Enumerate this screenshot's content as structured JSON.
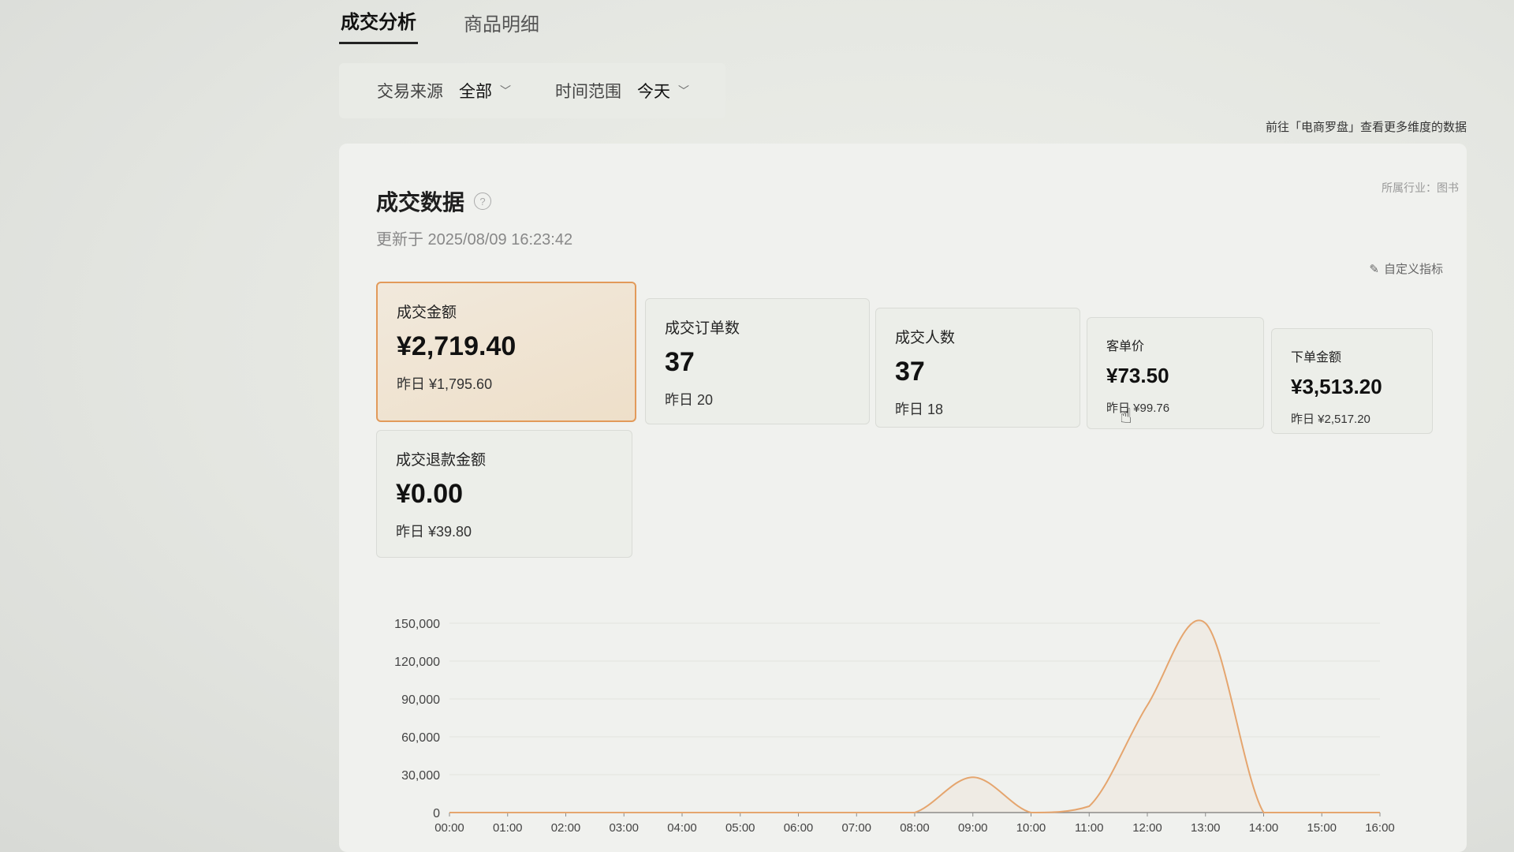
{
  "tabs": [
    {
      "label": "成交分析",
      "active": true
    },
    {
      "label": "商品明细",
      "active": false
    }
  ],
  "filters": {
    "source_label": "交易来源",
    "source_value": "全部",
    "time_label": "时间范围",
    "time_value": "今天"
  },
  "header": {
    "link_text": "前往「电商罗盘」查看更多维度的数据",
    "industry": "所属行业：图书",
    "title": "成交数据",
    "updated": "更新于 2025/08/09 16:23:42",
    "custom_metrics": "自定义指标"
  },
  "metrics": [
    {
      "label": "成交金额",
      "value": "¥2,719.40",
      "prev": "昨日 ¥1,795.60",
      "active": true
    },
    {
      "label": "成交订单数",
      "value": "37",
      "prev": "昨日 20",
      "active": false
    },
    {
      "label": "成交人数",
      "value": "37",
      "prev": "昨日 18",
      "active": false
    },
    {
      "label": "客单价",
      "value": "¥73.50",
      "prev": "昨日 ¥99.76",
      "active": false
    },
    {
      "label": "下单金额",
      "value": "¥3,513.20",
      "prev": "昨日 ¥2,517.20",
      "active": false
    },
    {
      "label": "成交退款金额",
      "value": "¥0.00",
      "prev": "昨日 ¥39.80",
      "active": false
    }
  ],
  "colors": {
    "accent": "#e29a5a",
    "line": "#e5a56e"
  },
  "chart_data": {
    "type": "area",
    "x": [
      "00:00",
      "01:00",
      "02:00",
      "03:00",
      "04:00",
      "05:00",
      "06:00",
      "07:00",
      "08:00",
      "09:00",
      "10:00",
      "11:00",
      "12:00",
      "13:00",
      "14:00",
      "15:00",
      "16:00"
    ],
    "y": [
      0,
      0,
      0,
      0,
      0,
      0,
      0,
      0,
      0,
      28000,
      0,
      5000,
      85000,
      150000,
      0,
      0,
      0
    ],
    "yticks": [
      "0",
      "30,000",
      "60,000",
      "90,000",
      "120,000",
      "150,000"
    ],
    "ylim": [
      0,
      150000
    ],
    "grid": true
  }
}
